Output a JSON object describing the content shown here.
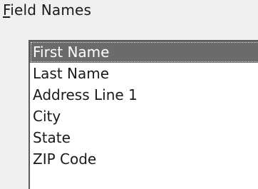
{
  "field_names": {
    "label_mnemonic": "F",
    "label_rest": "ield Names",
    "items": [
      {
        "label": "First Name",
        "selected": true
      },
      {
        "label": "Last Name",
        "selected": false
      },
      {
        "label": "Address Line 1",
        "selected": false
      },
      {
        "label": "City",
        "selected": false
      },
      {
        "label": "State",
        "selected": false
      },
      {
        "label": "ZIP Code",
        "selected": false
      }
    ]
  },
  "colors": {
    "selection_background": "#6b6b6b",
    "window_background": "#f0f0f0",
    "list_background": "#ffffff"
  }
}
